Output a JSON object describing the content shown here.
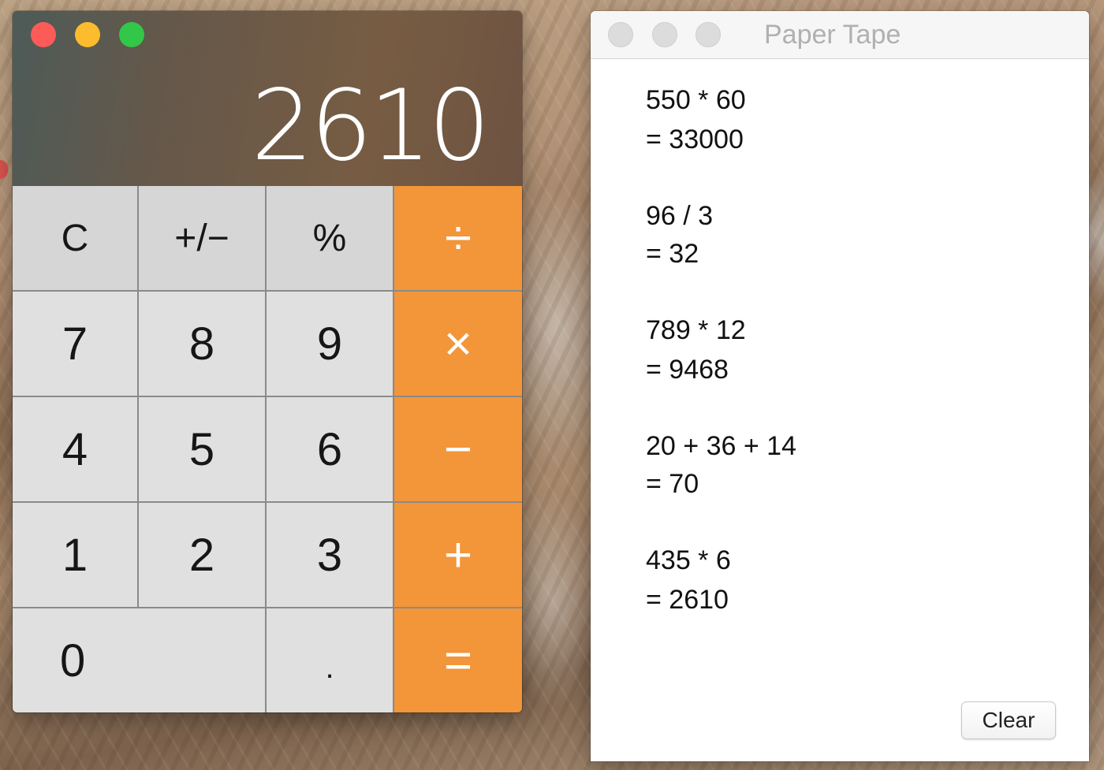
{
  "calculator": {
    "display": "2610",
    "keys": {
      "clear": "C",
      "sign": "+/−",
      "percent": "%",
      "divide": "÷",
      "seven": "7",
      "eight": "8",
      "nine": "9",
      "multiply": "×",
      "four": "4",
      "five": "5",
      "six": "6",
      "subtract": "−",
      "one": "1",
      "two": "2",
      "three": "3",
      "add": "+",
      "zero": "0",
      "decimal": ".",
      "equals": "="
    }
  },
  "paper_tape": {
    "title": "Paper Tape",
    "entries": [
      {
        "expression": "550 * 60",
        "result": "= 33000"
      },
      {
        "expression": "96 / 3",
        "result": "= 32"
      },
      {
        "expression": "789 * 12",
        "result": "= 9468"
      },
      {
        "expression": "20 + 36 + 14",
        "result": "= 70"
      },
      {
        "expression": "435 * 6",
        "result": "= 2610"
      }
    ],
    "clear_label": "Clear"
  },
  "colors": {
    "operator_orange": "#f39539",
    "key_gray": "#e0e0e0",
    "close": "#fc5b57",
    "minimize": "#fdbb2e",
    "maximize": "#32c748"
  }
}
